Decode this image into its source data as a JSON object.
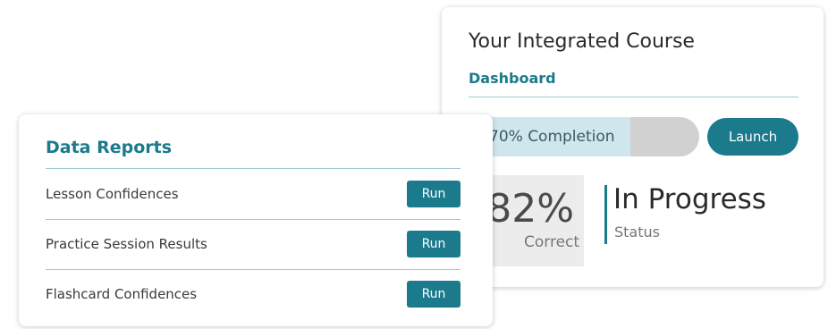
{
  "course": {
    "title": "Your Integrated Course",
    "subtitle": "Dashboard",
    "progress": {
      "label": "70% Completion",
      "percent": 70
    },
    "launch_label": "Launch",
    "score": {
      "value": "82%",
      "caption": "Correct"
    },
    "status": {
      "value": "In Progress",
      "caption": "Status"
    }
  },
  "reports": {
    "title": "Data Reports",
    "items": [
      {
        "label": "Lesson Confidences",
        "button": "Run"
      },
      {
        "label": "Practice Session Results",
        "button": "Run"
      },
      {
        "label": "Flashcard Confidences",
        "button": "Run"
      }
    ]
  },
  "colors": {
    "accent": "#1b7a8c",
    "progress_fill": "#cfe6ec",
    "progress_track": "#d1d1d1",
    "score_box": "#ececec"
  }
}
